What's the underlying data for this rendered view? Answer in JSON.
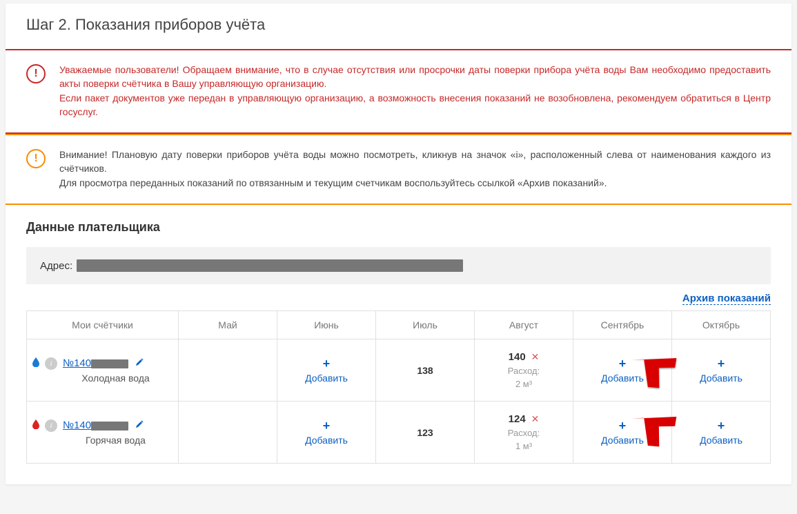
{
  "step_title": "Шаг 2. Показания приборов учёта",
  "alert1": {
    "line1": "Уважаемые пользователи! Обращаем внимание, что в случае отсутствия или просрочки даты поверки прибора учёта воды Вам необходимо предоставить акты поверки счётчика в Вашу управляющую организацию.",
    "line2": "Если пакет документов уже передан в управляющую организацию, а возможность внесения показаний не возобновлена, рекомендуем обратиться в Центр госуслуг."
  },
  "alert2": {
    "line1": "Внимание! Плановую дату поверки приборов учёта воды можно посмотреть, кликнув на значок «i», расположенный слева от наименования каждого из счётчиков.",
    "line2": "Для просмотра переданных показаний по отвязанным и текущим счетчикам воспользуйтесь ссылкой «Архив показаний»."
  },
  "payer_title": "Данные плательщика",
  "addr_label": "Адрес:",
  "archive_link": "Архив показаний",
  "columns": {
    "meters": "Мои счётчики",
    "may": "Май",
    "june": "Июнь",
    "july": "Июль",
    "august": "Август",
    "september": "Сентябрь",
    "october": "Октябрь"
  },
  "add_label": "Добавить",
  "rows": [
    {
      "number_prefix": "№140",
      "type": "Холодная вода",
      "kind": "cold",
      "july": "138",
      "august": {
        "value": "140",
        "consumption_label": "Расход:",
        "consumption_value": "2 м³"
      }
    },
    {
      "number_prefix": "№140",
      "type": "Горячая вода",
      "kind": "hot",
      "july": "123",
      "august": {
        "value": "124",
        "consumption_label": "Расход:",
        "consumption_value": "1 м³"
      }
    }
  ]
}
